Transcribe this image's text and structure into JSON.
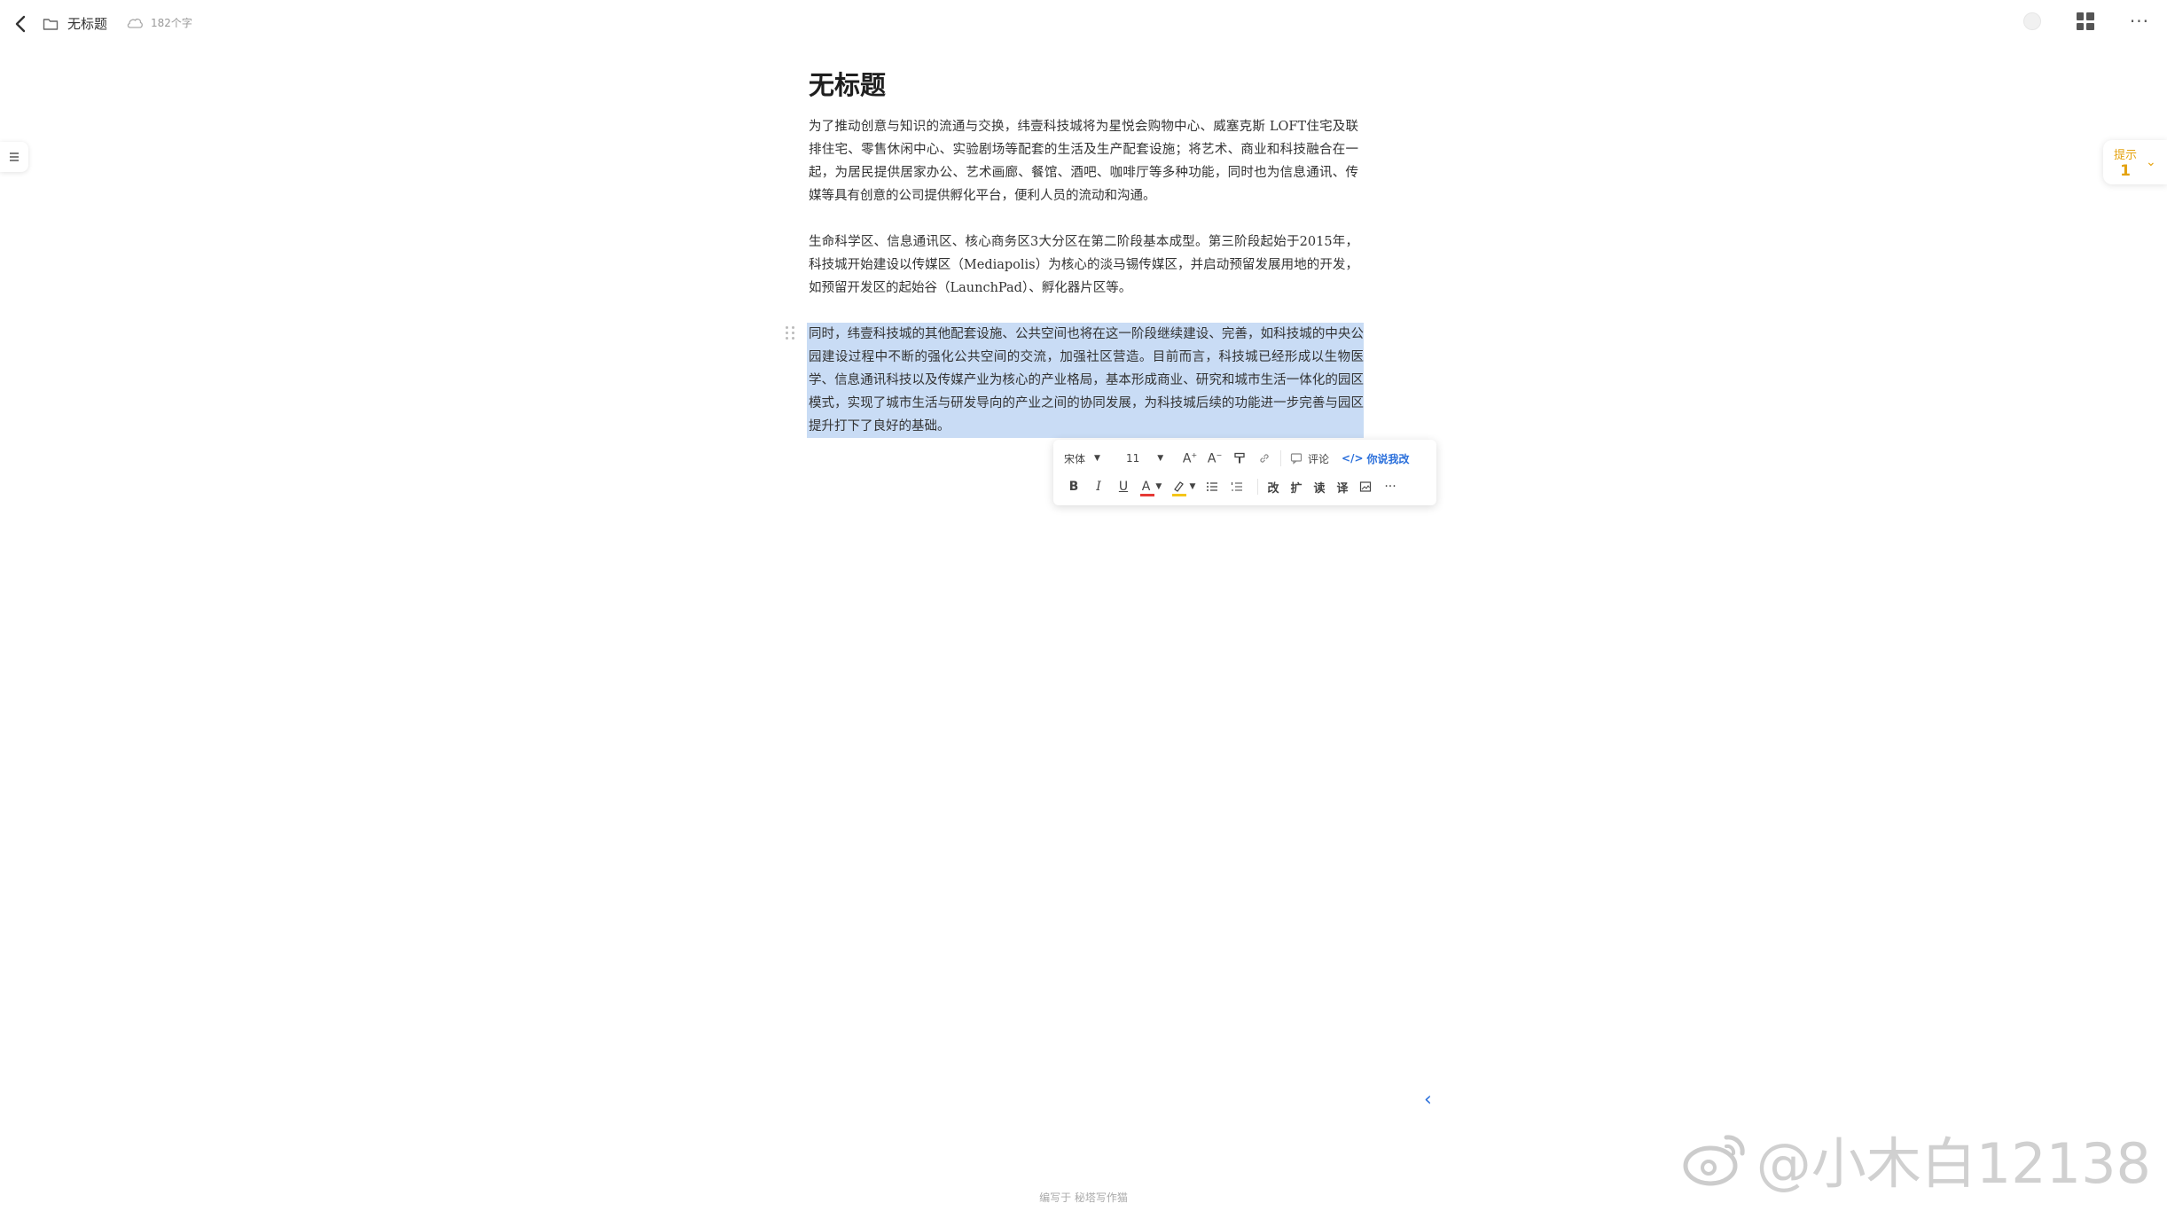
{
  "header": {
    "doc_name": "无标题",
    "word_count": "182个字"
  },
  "hint": {
    "label": "提示",
    "count": "1"
  },
  "document": {
    "title": "无标题",
    "paragraphs": [
      "为了推动创意与知识的流通与交换，纬壹科技城将为星悦会购物中心、威塞克斯 LOFT住宅及联排住宅、零售休闲中心、实验剧场等配套的生活及生产配套设施；将艺术、商业和科技融合在一起，为居民提供居家办公、艺术画廊、餐馆、酒吧、咖啡厅等多种功能，同时也为信息通讯、传媒等具有创意的公司提供孵化平台，便利人员的流动和沟通。",
      "生命科学区、信息通讯区、核心商务区3大分区在第二阶段基本成型。第三阶段起始于2015年，科技城开始建设以传媒区（Mediapolis）为核心的淡马锡传媒区，并启动预留发展用地的开发，如预留开发区的起始谷（LaunchPad）、孵化器片区等。",
      "同时，纬壹科技城的其他配套设施、公共空间也将在这一阶段继续建设、完善，如科技城的中央公园建设过程中不断的强化公共空间的交流，加强社区营造。目前而言，科技城已经形成以生物医学、信息通讯科技以及传媒产业为核心的产业格局，基本形成商业、研究和城市生活一体化的园区模式，实现了城市生活与研发导向的产业之间的协同发展，为科技城后续的功能进一步完善与园区提升打下了良好的基础。"
    ]
  },
  "toolbar": {
    "font": "宋体",
    "size": "11",
    "comment_label": "评论",
    "ai_label": "你说我改",
    "cjk_buttons": [
      "改",
      "扩",
      "读",
      "译"
    ]
  },
  "footer": {
    "text": "编写于 秘塔写作猫"
  },
  "watermark": {
    "text": "@小木白12138"
  }
}
